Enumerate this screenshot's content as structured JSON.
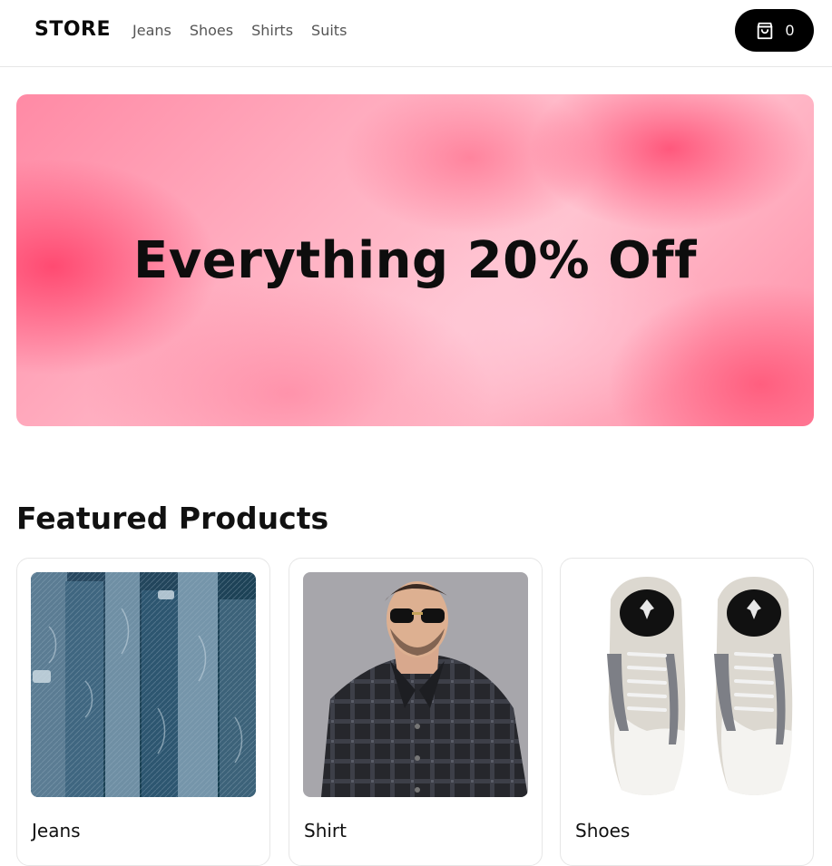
{
  "header": {
    "brand": "STORE",
    "nav": [
      {
        "label": "Jeans"
      },
      {
        "label": "Shoes"
      },
      {
        "label": "Shirts"
      },
      {
        "label": "Suits"
      }
    ],
    "cart": {
      "icon": "shopping-bag-icon",
      "count": "0"
    }
  },
  "hero": {
    "headline": "Everything 20% Off",
    "background_color": "#ff8aa5"
  },
  "featured": {
    "title": "Featured Products",
    "products": [
      {
        "label": "Jeans",
        "image": "denim-jeans-stack-photo"
      },
      {
        "label": "Shirt",
        "image": "man-in-checked-shirt-photo"
      },
      {
        "label": "Shoes",
        "image": "sneakers-pair-photo"
      }
    ]
  },
  "colors": {
    "accent": "#000000",
    "nav_text": "#555555",
    "border": "#e6e6e6"
  }
}
